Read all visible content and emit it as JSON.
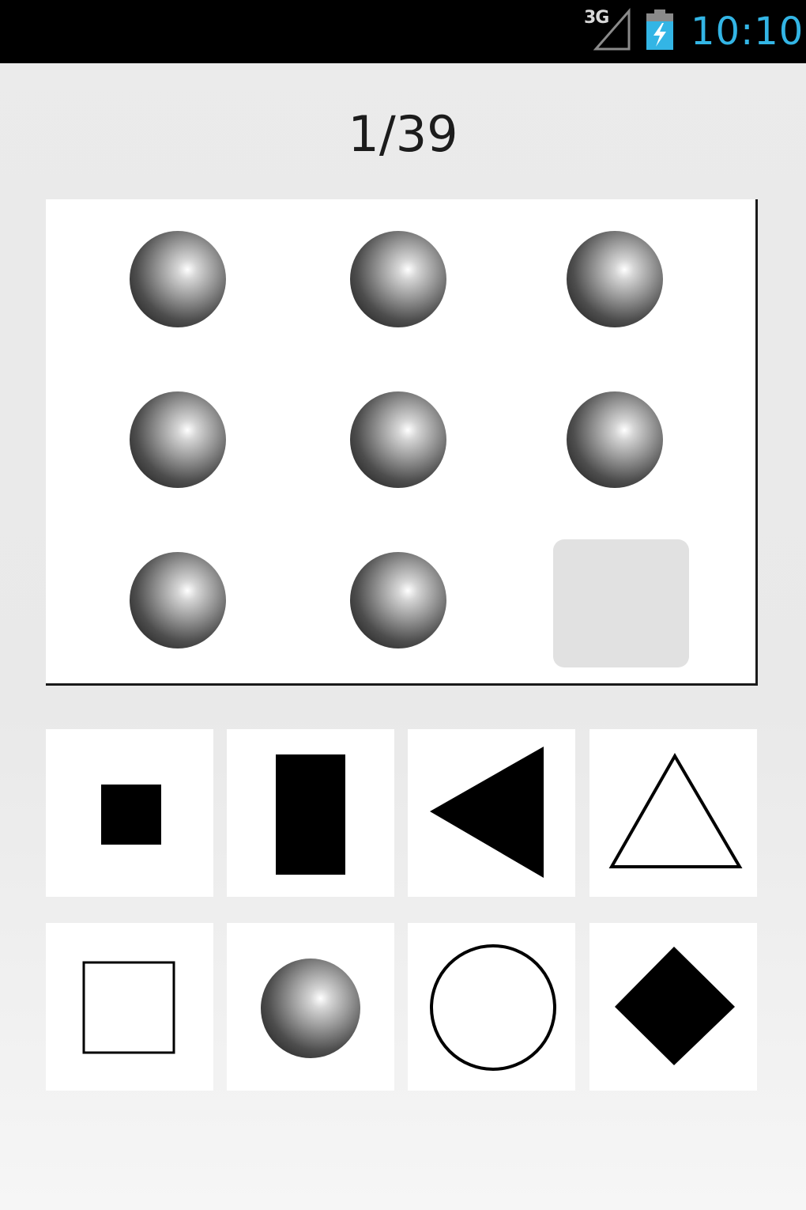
{
  "status_bar": {
    "network": "3G",
    "signal_icon": "signal-strength-icon",
    "battery_icon": "battery-charging-icon",
    "time": "10:10",
    "accent_color": "#33b5e5"
  },
  "quiz": {
    "progress": "1/39",
    "current_question": 1,
    "total_questions": 39
  },
  "matrix": {
    "cells": [
      {
        "shape": "sphere"
      },
      {
        "shape": "sphere"
      },
      {
        "shape": "sphere"
      },
      {
        "shape": "sphere"
      },
      {
        "shape": "sphere"
      },
      {
        "shape": "sphere"
      },
      {
        "shape": "sphere"
      },
      {
        "shape": "sphere"
      },
      {
        "shape": "missing"
      }
    ]
  },
  "options": [
    {
      "shape": "small-filled-square"
    },
    {
      "shape": "filled-rectangle"
    },
    {
      "shape": "filled-left-triangle"
    },
    {
      "shape": "outline-triangle"
    },
    {
      "shape": "outline-square"
    },
    {
      "shape": "sphere"
    },
    {
      "shape": "outline-circle"
    },
    {
      "shape": "filled-diamond"
    }
  ]
}
